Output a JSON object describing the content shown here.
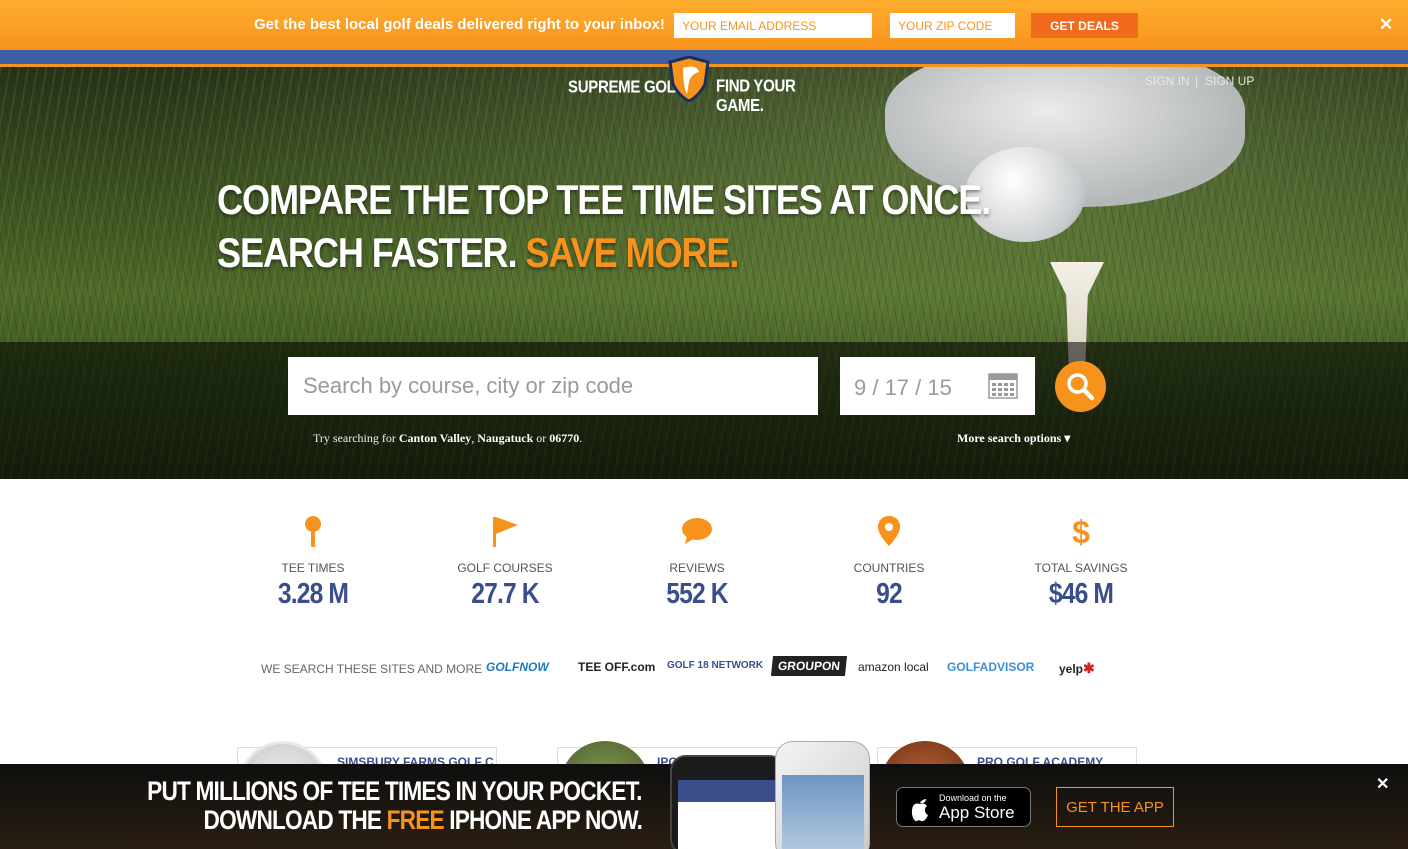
{
  "promo": {
    "text": "Get the best local golf deals delivered right to your inbox!",
    "email_placeholder": "YOUR EMAIL ADDRESS",
    "zip_placeholder": "YOUR ZIP CODE",
    "button": "GET DEALS",
    "close": "✕"
  },
  "header": {
    "brand": "SUPREME GOLF",
    "tagline": "FIND YOUR GAME.",
    "sign_in": "SIGN IN",
    "separator": "|",
    "sign_up": "SIGN UP"
  },
  "hero": {
    "line1": "COMPARE THE TOP TEE TIME SITES AT ONCE.",
    "line2_a": "SEARCH FASTER.",
    "line2_b": "SAVE MORE."
  },
  "search": {
    "placeholder": "Search by course, city or zip code",
    "date": "9 / 17 / 15",
    "try_prefix": "Try searching for",
    "try_1": "Canton Valley",
    "try_2": "Naugatuck",
    "try_or": "or",
    "try_3": "06770",
    "more_options": "More search options ▾"
  },
  "stats": [
    {
      "label": "TEE TIMES",
      "value": "3.28 M",
      "icon": "tee-icon"
    },
    {
      "label": "GOLF COURSES",
      "value": "27.7 K",
      "icon": "flag-icon"
    },
    {
      "label": "REVIEWS",
      "value": "552 K",
      "icon": "chat-icon"
    },
    {
      "label": "COUNTRIES",
      "value": "92",
      "icon": "map-pin-icon"
    },
    {
      "label": "TOTAL SAVINGS",
      "value": "$46 M",
      "icon": "dollar-icon"
    }
  ],
  "sites": {
    "label": "WE SEARCH THESE SITES AND MORE",
    "logos": [
      "GOLFNOW",
      "TEE OFF.com",
      "GOLF 18 NETWORK",
      "GROUPON",
      "amazon local",
      "GOLFADVISOR",
      "yelp"
    ]
  },
  "cards": [
    {
      "title": "SIMSBURY FARMS GOLF C"
    },
    {
      "title": "IPO"
    },
    {
      "title": "PRO GOLF ACADEMY"
    }
  ],
  "app_bar": {
    "line1": "PUT MILLIONS OF TEE TIMES IN YOUR POCKET.",
    "line2_a": "DOWNLOAD THE",
    "line2_free": "FREE",
    "line2_b": "IPHONE APP NOW.",
    "appstore_small": "Download on the",
    "appstore_big": "App Store",
    "get_app": "GET THE APP",
    "close": "✕"
  },
  "colors": {
    "orange": "#f7931d",
    "navy": "#3b4e8c",
    "blue_band": "#3f5fa4"
  }
}
